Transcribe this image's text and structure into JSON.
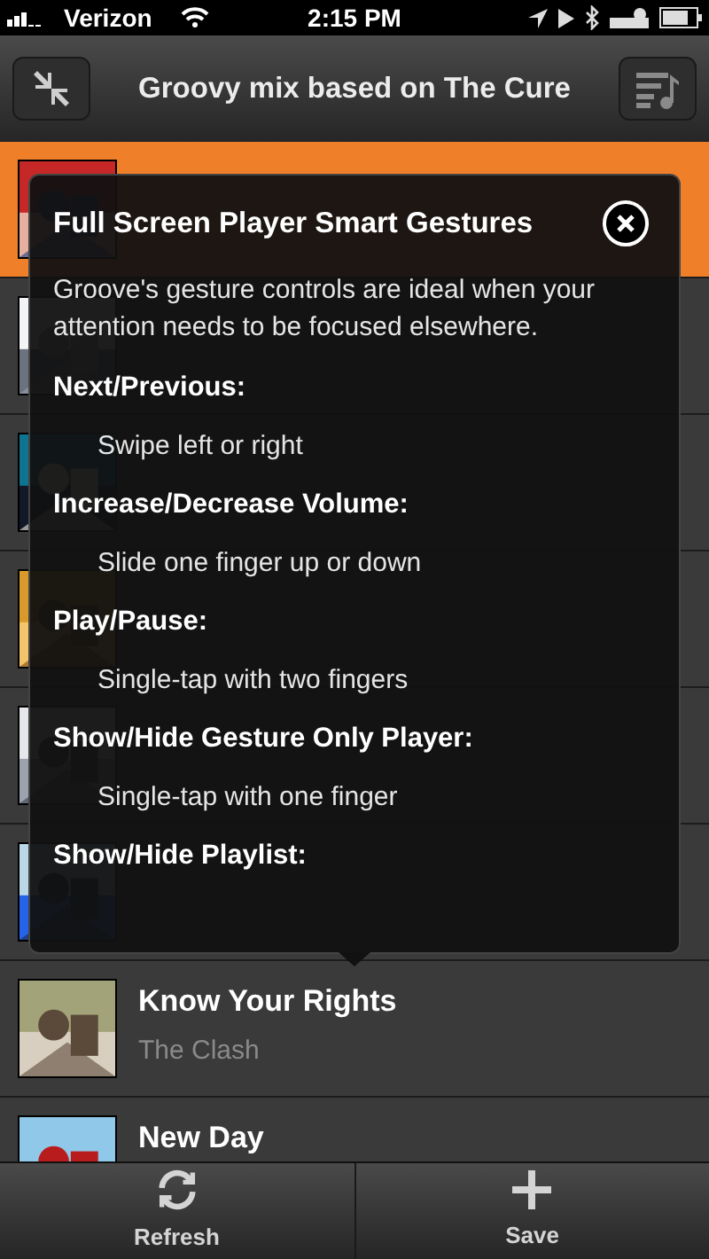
{
  "status_bar": {
    "carrier": "Verizon",
    "time": "2:15 PM"
  },
  "nav": {
    "title": "Groovy mix based on The Cure"
  },
  "rows": [
    {
      "selected": true
    },
    {
      "selected": false
    },
    {
      "selected": false
    },
    {
      "selected": false
    },
    {
      "selected": false
    },
    {
      "selected": false
    },
    {
      "selected": false,
      "title": "Know Your Rights",
      "artist": "The Clash"
    },
    {
      "selected": false,
      "title": "New Day"
    }
  ],
  "overlay": {
    "title": "Full Screen Player Smart Gestures",
    "intro": "Groove's gesture controls are ideal when your attention needs to be focused elsewhere.",
    "gestures": [
      {
        "name": "Next/Previous:",
        "how": "Swipe left or right"
      },
      {
        "name": "Increase/Decrease Volume:",
        "how": "Slide one finger up or down"
      },
      {
        "name": "Play/Pause:",
        "how": "Single-tap with two fingers"
      },
      {
        "name": "Show/Hide Gesture Only Player:",
        "how": "Single-tap with one finger"
      },
      {
        "name": "Show/Hide Playlist:"
      }
    ]
  },
  "toolbar": [
    {
      "kind": "refresh",
      "label": "Refresh"
    },
    {
      "kind": "save",
      "label": "Save"
    }
  ]
}
